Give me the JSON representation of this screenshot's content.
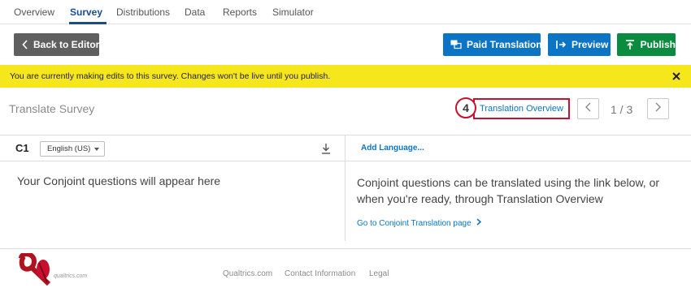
{
  "nav": {
    "tabs": [
      "Overview",
      "Survey",
      "Distributions",
      "Data",
      "Reports",
      "Simulator"
    ],
    "active": "Survey"
  },
  "toolbar": {
    "back_label": "Back to Editor",
    "paid_label": "Paid Translations",
    "preview_label": "Preview",
    "publish_label": "Publish"
  },
  "warning": {
    "message": "You are currently making edits to this survey. Changes won't be live until you publish."
  },
  "translate": {
    "title": "Translate Survey",
    "step_number": "4",
    "overview_link": "Translation Overview",
    "pager": "1 / 3"
  },
  "question": {
    "id": "C1",
    "language": "English (US)",
    "add_language": "Add Language...",
    "left_message": "Your Conjoint questions will appear here",
    "right_message": "Conjoint questions can be translated using the link below, or when you're ready, through Translation Overview",
    "conjoint_link": "Go to Conjoint Translation page"
  },
  "footer": {
    "logo_text": "qualtrics.com",
    "links": [
      "Qualtrics.com",
      "Contact Information",
      "Legal"
    ]
  },
  "colors": {
    "primary": "#0b74c4",
    "publish": "#0a8b3f",
    "back": "#5f5f5f",
    "warning": "#f5e71c",
    "highlight": "#c8102e",
    "active_tab": "#1a4d8f"
  }
}
